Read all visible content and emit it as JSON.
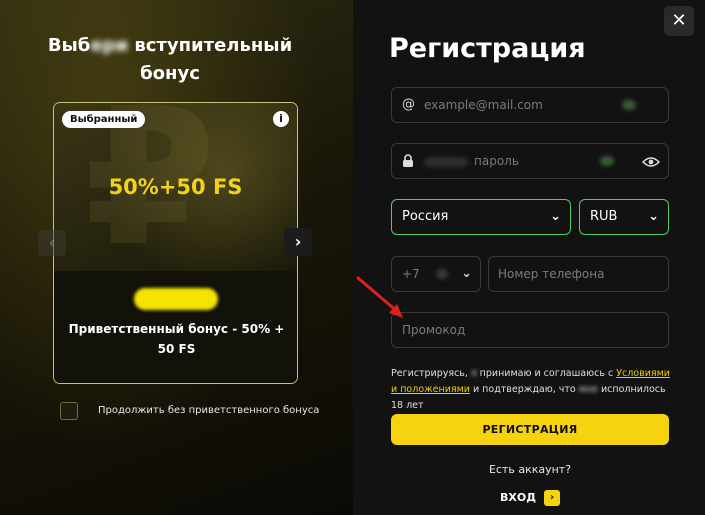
{
  "bonus_panel": {
    "title_line1_start": "Выб",
    "title_line1_blur": "ери",
    "title_line1_end": " вступительный",
    "title_line2": "бонус",
    "card": {
      "badge": "Выбранный",
      "info_icon": "i",
      "amount": "50%+50 FS",
      "description": "Приветственный бонус - 50% + 50 FS"
    },
    "nav_prev_icon": "‹",
    "nav_next_icon": "›",
    "skip_bonus_label": "Продолжить без приветственного бонуса"
  },
  "registration": {
    "close_icon": "✕",
    "title": "Регистрация",
    "email": {
      "icon": "@",
      "placeholder": "example@mail.com"
    },
    "password": {
      "icon": "lock-icon",
      "placeholder": "пароль",
      "eye_icon": "eye-icon"
    },
    "country": {
      "value": "Россия"
    },
    "currency": {
      "value": "RUB"
    },
    "phone": {
      "code": "+7",
      "placeholder": "Номер телефона"
    },
    "promo": {
      "placeholder": "Промокод"
    },
    "terms": {
      "part1": "Регистрируясь, ",
      "part1_blur": "я",
      "part2": " принимаю и соглашаюсь с ",
      "link1": "Условиями",
      "link2": "и положениями",
      "part3": " и подтверждаю, что ",
      "part3_blur": "мне",
      "part4": " исполнилось 18 лет"
    },
    "submit_label": "РЕГИСТРАЦИЯ",
    "have_account": "Есть аккаунт?",
    "login_label": "ВХОД",
    "login_icon": "›"
  },
  "colors": {
    "accent_yellow": "#f5d30f",
    "select_border_green": "#4ecf6b",
    "annotation_red": "#e0201a"
  }
}
